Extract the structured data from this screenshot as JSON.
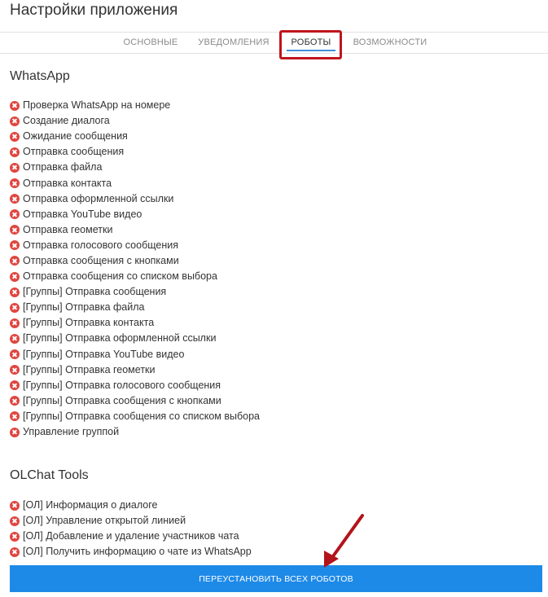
{
  "header": {
    "title": "Настройки приложения"
  },
  "tabs": [
    {
      "label": "ОСНОВНЫЕ"
    },
    {
      "label": "УВЕДОМЛЕНИЯ"
    },
    {
      "label": "РОБОТЫ",
      "active": true
    },
    {
      "label": "ВОЗМОЖНОСТИ"
    }
  ],
  "whatsapp": {
    "title": "WhatsApp",
    "items": [
      "Проверка WhatsApp на номере",
      "Создание диалога",
      "Ожидание сообщения",
      "Отправка сообщения",
      "Отправка файла",
      "Отправка контакта",
      "Отправка оформленной ссылки",
      "Отправка YouTube видео",
      "Отправка геометки",
      "Отправка голосового сообщения",
      "Отправка сообщения с кнопками",
      "Отправка сообщения со списком выбора",
      "[Группы] Отправка сообщения",
      "[Группы] Отправка файла",
      "[Группы] Отправка контакта",
      "[Группы] Отправка оформленной ссылки",
      "[Группы] Отправка YouTube видео",
      "[Группы] Отправка геометки",
      "[Группы] Отправка голосового сообщения",
      "[Группы] Отправка сообщения с кнопками",
      "[Группы] Отправка сообщения со списком выбора",
      "Управление группой"
    ]
  },
  "olchat": {
    "title": "OLChat Tools",
    "items": [
      "[ОЛ] Информация о диалоге",
      "[ОЛ] Управление открытой линией",
      "[ОЛ] Добавление и удаление участников чата",
      "[ОЛ] Получить информацию о чате из WhatsApp"
    ]
  },
  "actions": {
    "reinstall_label": "ПЕРЕУСТАНОВИТЬ ВСЕХ РОБОТОВ"
  },
  "icons": {
    "status": "x-circle-icon"
  },
  "colors": {
    "accent": "#1e8ae8",
    "error": "#e0453f",
    "annotation": "#c0141c"
  }
}
